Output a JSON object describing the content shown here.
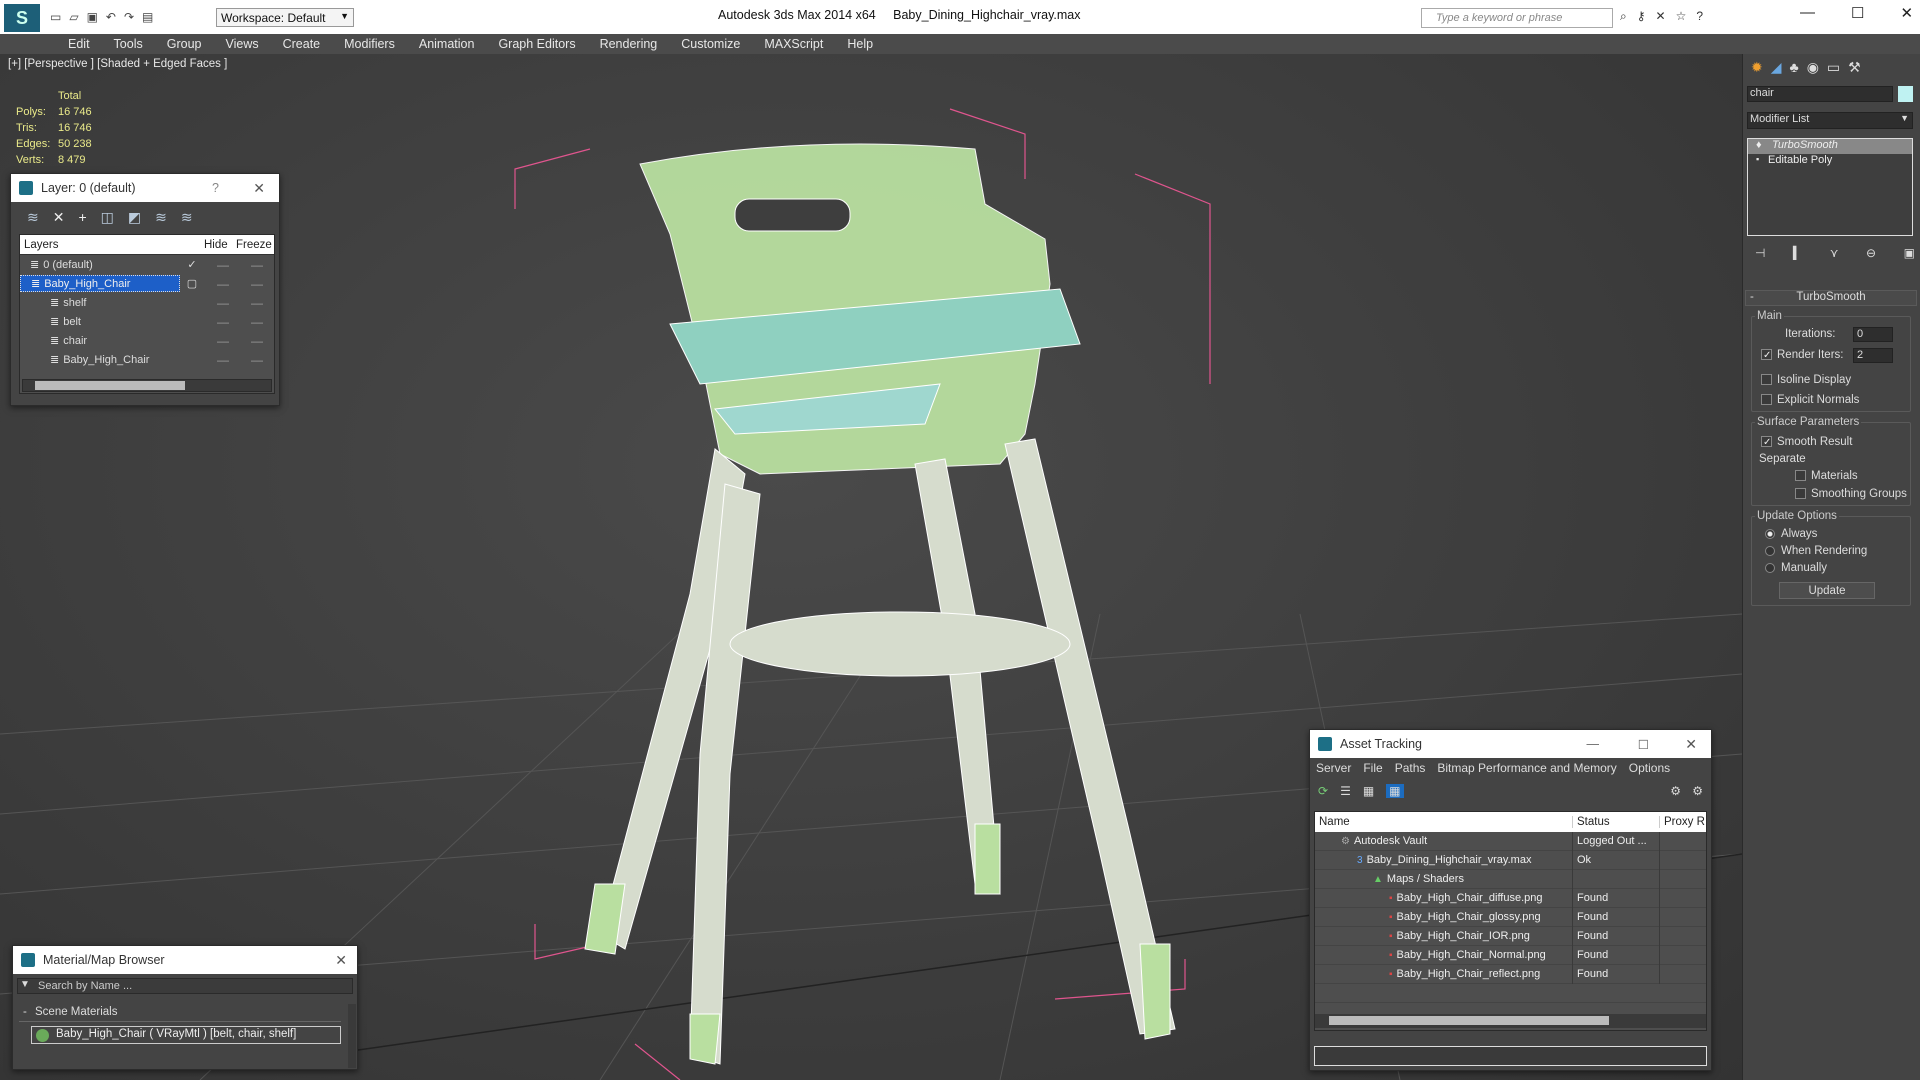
{
  "titlebar": {
    "app": "Autodesk 3ds Max  2014 x64",
    "file": "Baby_Dining_Highchair_vray.max",
    "workspace": "Workspace: Default",
    "search_placeholder": "Type a keyword or phrase"
  },
  "menu": [
    "Edit",
    "Tools",
    "Group",
    "Views",
    "Create",
    "Modifiers",
    "Animation",
    "Graph Editors",
    "Rendering",
    "Customize",
    "MAXScript",
    "Help"
  ],
  "viewport": {
    "label": "[+] [Perspective ] [Shaded + Edged Faces ]",
    "stats": {
      "header": "Total",
      "rows": [
        {
          "k": "Polys:",
          "v": "16 746"
        },
        {
          "k": "Tris:",
          "v": "16 746"
        },
        {
          "k": "Edges:",
          "v": "50 238"
        },
        {
          "k": "Verts:",
          "v": "8 479"
        }
      ]
    }
  },
  "layer_window": {
    "title": "Layer: 0 (default)",
    "help": "?",
    "cols": {
      "layers": "Layers",
      "hide": "Hide",
      "freeze": "Freeze"
    },
    "rows": [
      {
        "name": "0 (default)",
        "indent": 1,
        "checked": true
      },
      {
        "name": "Baby_High_Chair",
        "indent": 1,
        "selected": true
      },
      {
        "name": "shelf",
        "indent": 2
      },
      {
        "name": "belt",
        "indent": 2
      },
      {
        "name": "chair",
        "indent": 2
      },
      {
        "name": "Baby_High_Chair",
        "indent": 2
      }
    ]
  },
  "material_browser": {
    "title": "Material/Map Browser",
    "search_placeholder": "Search by Name ...",
    "section": "Scene Materials",
    "item": "Baby_High_Chair  ( VRayMtl )  [belt, chair, shelf]"
  },
  "asset_tracking": {
    "title": "Asset Tracking",
    "menu": [
      "Server",
      "File",
      "Paths",
      "Bitmap Performance and Memory",
      "Options"
    ],
    "cols": [
      "Name",
      "Status",
      "Proxy R"
    ],
    "rows": [
      {
        "name": "Autodesk Vault",
        "status": "Logged Out ...",
        "indent": 0,
        "icon": "vault"
      },
      {
        "name": "Baby_Dining_Highchair_vray.max",
        "status": "Ok",
        "indent": 1,
        "icon": "max"
      },
      {
        "name": "Maps / Shaders",
        "status": "",
        "indent": 2,
        "icon": "maps"
      },
      {
        "name": "Baby_High_Chair_diffuse.png",
        "status": "Found",
        "indent": 3,
        "icon": "png"
      },
      {
        "name": "Baby_High_Chair_glossy.png",
        "status": "Found",
        "indent": 3,
        "icon": "png"
      },
      {
        "name": "Baby_High_Chair_IOR.png",
        "status": "Found",
        "indent": 3,
        "icon": "png"
      },
      {
        "name": "Baby_High_Chair_Normal.png",
        "status": "Found",
        "indent": 3,
        "icon": "png"
      },
      {
        "name": "Baby_High_Chair_reflect.png",
        "status": "Found",
        "indent": 3,
        "icon": "png"
      }
    ]
  },
  "command_panel": {
    "object_name": "chair",
    "modifier_list": "Modifier List",
    "stack": [
      "TurboSmooth",
      "Editable Poly"
    ],
    "rollout": "TurboSmooth",
    "main": "Main",
    "iterations_label": "Iterations:",
    "iterations": "0",
    "render_iters_label": "Render Iters:",
    "render_iters": "2",
    "isoline": "Isoline Display",
    "explicit": "Explicit Normals",
    "surface": "Surface Parameters",
    "smooth": "Smooth Result",
    "separate": "Separate",
    "materials": "Materials",
    "smoothing_groups": "Smoothing Groups",
    "update_options": "Update Options",
    "always": "Always",
    "when_rendering": "When Rendering",
    "manually": "Manually",
    "update": "Update"
  },
  "colors": {
    "accent": "#1c6cc0",
    "selection": "#1d5fc8",
    "chair": "#b9dfa0",
    "wire": "#ffffff",
    "bbox": "#e0558e"
  }
}
